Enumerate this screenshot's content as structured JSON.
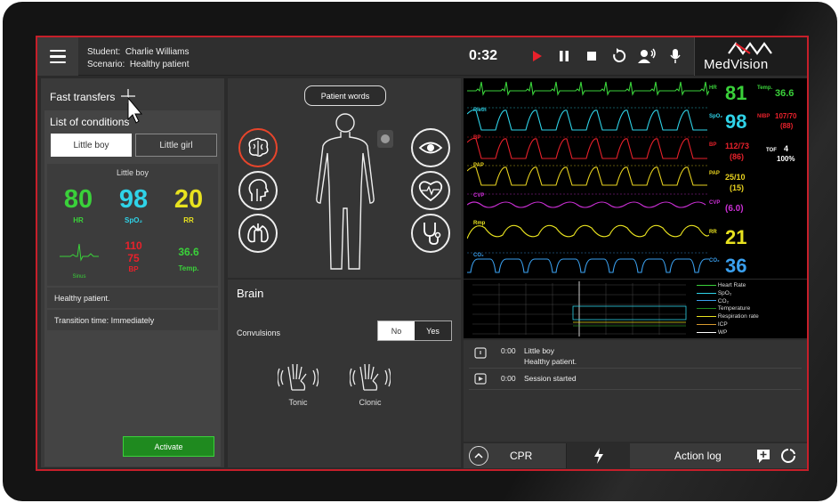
{
  "header": {
    "student_label": "Student:",
    "student_name": "Charlie Williams",
    "scenario_label": "Scenario:",
    "scenario_name": "Healthy patient",
    "timer": "0:32",
    "logo": "MedVision"
  },
  "left": {
    "fast_transfers": "Fast transfers",
    "list_title": "List of conditions",
    "tabs": [
      "Little boy",
      "Little girl"
    ],
    "card_title": "Little boy",
    "hr": {
      "value": "80",
      "label": "HR"
    },
    "spo2": {
      "value": "98",
      "label": "SpO₂"
    },
    "rr": {
      "value": "20",
      "label": "RR"
    },
    "rhythm": "Sinus",
    "bp": {
      "sys": "110",
      "dia": "75",
      "label": "BP"
    },
    "temp": {
      "value": "36.6",
      "label": "Temp."
    },
    "description": "Healthy patient.",
    "transition": "Transition time: Immediately",
    "activate": "Activate"
  },
  "patient": {
    "bubble": "Patient words"
  },
  "brain": {
    "title": "Brain",
    "convulsions": "Convulsions",
    "no": "No",
    "yes": "Yes",
    "tonic": "Tonic",
    "clonic": "Clonic"
  },
  "monitor": {
    "wave_labels": [
      "Pleth",
      "BP",
      "PAP",
      "CVP",
      "Rmp",
      "CO₂"
    ],
    "hr": {
      "label": "HR",
      "value": "81"
    },
    "temp": {
      "label": "Temp.",
      "value": "36.6"
    },
    "spo2": {
      "label": "SpO₂",
      "value": "98"
    },
    "nibp": {
      "label": "NIBP",
      "value": "107/70",
      "mean": "(88)"
    },
    "bp": {
      "label": "BP",
      "value": "112/73",
      "mean": "(86)"
    },
    "tof": {
      "label": "TOF",
      "value": "4",
      "pct": "100%"
    },
    "pap": {
      "label": "PAP",
      "value": "25/10",
      "mean": "(15)"
    },
    "cvp": {
      "label": "CVP",
      "value": "(6.0)"
    },
    "rr": {
      "label": "RR",
      "value": "21"
    },
    "co2": {
      "label": "CO₂",
      "value": "36"
    },
    "colors": {
      "ecg": "#3ad13a",
      "spo2": "#2fd3e8",
      "bp": "#e8212b",
      "pap": "#e8d21f",
      "cvp": "#cc2fd6",
      "rr": "#e8e21f",
      "co2": "#3aa0ef"
    }
  },
  "trend_legend": [
    "Heart Rate",
    "SpO₂",
    "CO₂",
    "Temperature",
    "Respiration rate",
    "ICP",
    "WP"
  ],
  "log": [
    {
      "time": "0:00",
      "title": "Little boy",
      "detail": "Healthy patient."
    },
    {
      "time": "0:00",
      "title": "Session started",
      "detail": ""
    }
  ],
  "bottom": {
    "cpr": "CPR",
    "action_log": "Action log"
  }
}
